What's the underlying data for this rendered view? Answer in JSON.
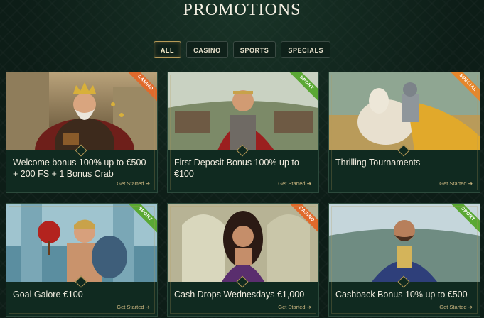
{
  "page": {
    "title": "PROMOTIONS"
  },
  "filters": [
    {
      "label": "ALL",
      "active": true
    },
    {
      "label": "CASINO",
      "active": false
    },
    {
      "label": "SPORTS",
      "active": false
    },
    {
      "label": "SPECIALS",
      "active": false
    }
  ],
  "cards": [
    {
      "title": "Welcome bonus 100% up to €500 + 200 FS + 1 Bonus Crab",
      "tag": "CASINO",
      "tag_color": "#e06a2c",
      "cta": "Get Started"
    },
    {
      "title": "First Deposit Bonus 100% up to €100",
      "tag": "SPORT",
      "tag_color": "#5aa834",
      "cta": "Get Started"
    },
    {
      "title": "Thrilling Tournaments",
      "tag": "SPECIAL",
      "tag_color": "#e5862c",
      "cta": "Get Started"
    },
    {
      "title": "Goal Galore €100",
      "tag": "SPORT",
      "tag_color": "#5aa834",
      "cta": "Get Started"
    },
    {
      "title": "Cash Drops Wednesdays €1,000",
      "tag": "CASINO",
      "tag_color": "#e06a2c",
      "cta": "Get Started"
    },
    {
      "title": "Cashback Bonus 10% up to €500",
      "tag": "SPORT",
      "tag_color": "#5aa834",
      "cta": "Get Started"
    }
  ]
}
